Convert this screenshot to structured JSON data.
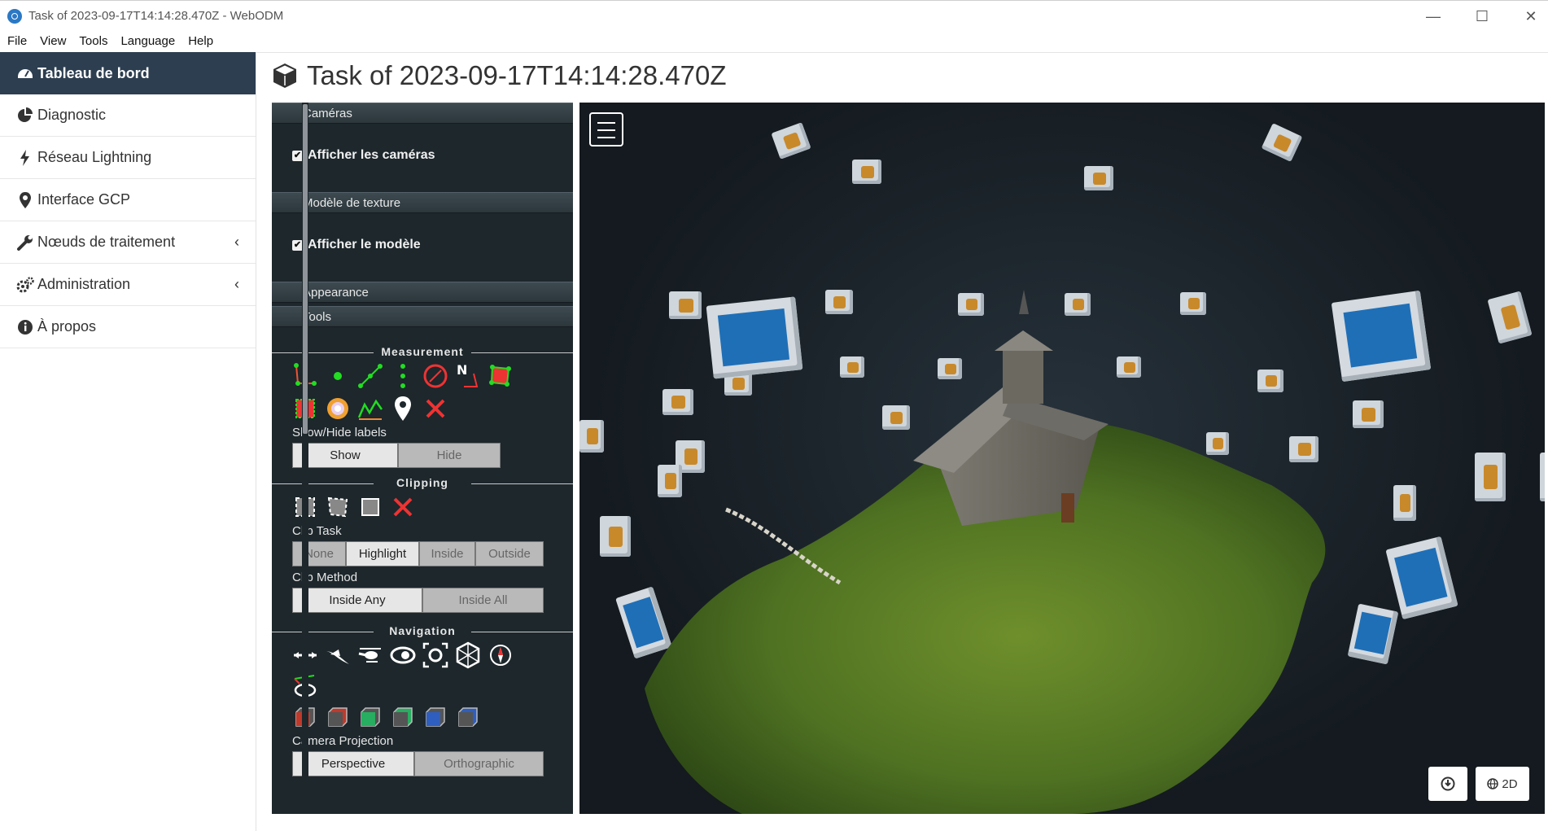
{
  "window": {
    "title": "Task of 2023-09-17T14:14:28.470Z - WebODM",
    "minimize": "—",
    "maximize": "☐",
    "close": "✕"
  },
  "menu": [
    "File",
    "View",
    "Tools",
    "Language",
    "Help"
  ],
  "sidebar": {
    "items": [
      {
        "label": "Tableau de bord",
        "icon": "dashboard-icon"
      },
      {
        "label": "Diagnostic",
        "icon": "pie-chart-icon"
      },
      {
        "label": "Réseau Lightning",
        "icon": "bolt-icon"
      },
      {
        "label": "Interface GCP",
        "icon": "map-marker-icon"
      },
      {
        "label": "Nœuds de traitement",
        "icon": "wrench-icon"
      },
      {
        "label": "Administration",
        "icon": "gears-icon"
      },
      {
        "label": "À propos",
        "icon": "info-icon"
      }
    ],
    "chevron": "‹"
  },
  "page": {
    "title": "Task of 2023-09-17T14:14:28.470Z"
  },
  "panel": {
    "cameras_header": "Caméras",
    "show_cameras": "Afficher les caméras",
    "texture_header": "Modèle de texture",
    "show_model": "Afficher le modèle",
    "appearance_header": "Appearance",
    "tools_header": "Tools",
    "measurement_title": "Measurement",
    "labels_title": "Show/Hide labels",
    "labels_show": "Show",
    "labels_hide": "Hide",
    "clipping_title": "Clipping",
    "clip_task_label": "Clip Task",
    "clip_task_options": [
      "None",
      "Highlight",
      "Inside",
      "Outside"
    ],
    "clip_task_selected": "Highlight",
    "clip_method_label": "Clip Method",
    "clip_method_options": [
      "Inside Any",
      "Inside All"
    ],
    "clip_method_selected": "Inside Any",
    "navigation_title": "Navigation",
    "projection_label": "Camera Projection",
    "projection_options": [
      "Perspective",
      "Orthographic"
    ],
    "projection_selected": "Perspective"
  },
  "viewport": {
    "mode_button": "2D"
  }
}
